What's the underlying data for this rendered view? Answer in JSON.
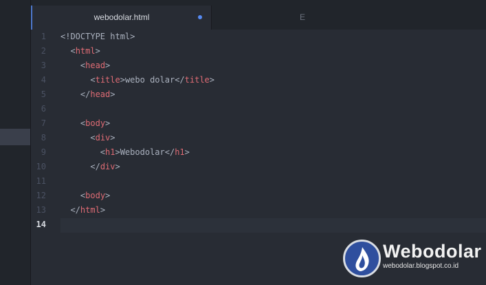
{
  "tabs": {
    "active": {
      "label": "webodolar.html",
      "modified": true
    },
    "second": {
      "label": "E"
    }
  },
  "editor": {
    "lines": [
      {
        "num": "1",
        "indent": "",
        "parts": [
          [
            "t",
            "<!DOCTYPE html>"
          ]
        ]
      },
      {
        "num": "2",
        "indent": "  ",
        "parts": [
          [
            "t",
            "<"
          ],
          [
            "g",
            "html"
          ],
          [
            "t",
            ">"
          ]
        ]
      },
      {
        "num": "3",
        "indent": "    ",
        "parts": [
          [
            "t",
            "<"
          ],
          [
            "g",
            "head"
          ],
          [
            "t",
            ">"
          ]
        ]
      },
      {
        "num": "4",
        "indent": "      ",
        "parts": [
          [
            "t",
            "<"
          ],
          [
            "g",
            "title"
          ],
          [
            "t",
            ">webo dolar</"
          ],
          [
            "g",
            "title"
          ],
          [
            "t",
            ">"
          ]
        ]
      },
      {
        "num": "5",
        "indent": "    ",
        "parts": [
          [
            "t",
            "</"
          ],
          [
            "g",
            "head"
          ],
          [
            "t",
            ">"
          ]
        ]
      },
      {
        "num": "6",
        "indent": "",
        "parts": []
      },
      {
        "num": "7",
        "indent": "    ",
        "parts": [
          [
            "t",
            "<"
          ],
          [
            "g",
            "body"
          ],
          [
            "t",
            ">"
          ]
        ]
      },
      {
        "num": "8",
        "indent": "      ",
        "parts": [
          [
            "t",
            "<"
          ],
          [
            "g",
            "div"
          ],
          [
            "t",
            ">"
          ]
        ]
      },
      {
        "num": "9",
        "indent": "        ",
        "parts": [
          [
            "t",
            "<"
          ],
          [
            "g",
            "h1"
          ],
          [
            "t",
            ">Webodolar</"
          ],
          [
            "g",
            "h1"
          ],
          [
            "t",
            ">"
          ]
        ]
      },
      {
        "num": "10",
        "indent": "      ",
        "parts": [
          [
            "t",
            "</"
          ],
          [
            "g",
            "div"
          ],
          [
            "t",
            ">"
          ]
        ]
      },
      {
        "num": "11",
        "indent": "",
        "parts": []
      },
      {
        "num": "12",
        "indent": "    ",
        "parts": [
          [
            "t",
            "<"
          ],
          [
            "g",
            "body"
          ],
          [
            "t",
            ">"
          ]
        ]
      },
      {
        "num": "13",
        "indent": "  ",
        "parts": [
          [
            "t",
            "</"
          ],
          [
            "g",
            "html"
          ],
          [
            "t",
            ">"
          ]
        ]
      },
      {
        "num": "14",
        "indent": "",
        "parts": [],
        "active": true
      }
    ]
  },
  "watermark": {
    "name": "Webodolar",
    "url": "webodolar.blogspot.co.id"
  },
  "colors": {
    "background": "#282c34",
    "tag": "#e06c75",
    "text": "#abb2bf",
    "accent": "#568af2"
  }
}
